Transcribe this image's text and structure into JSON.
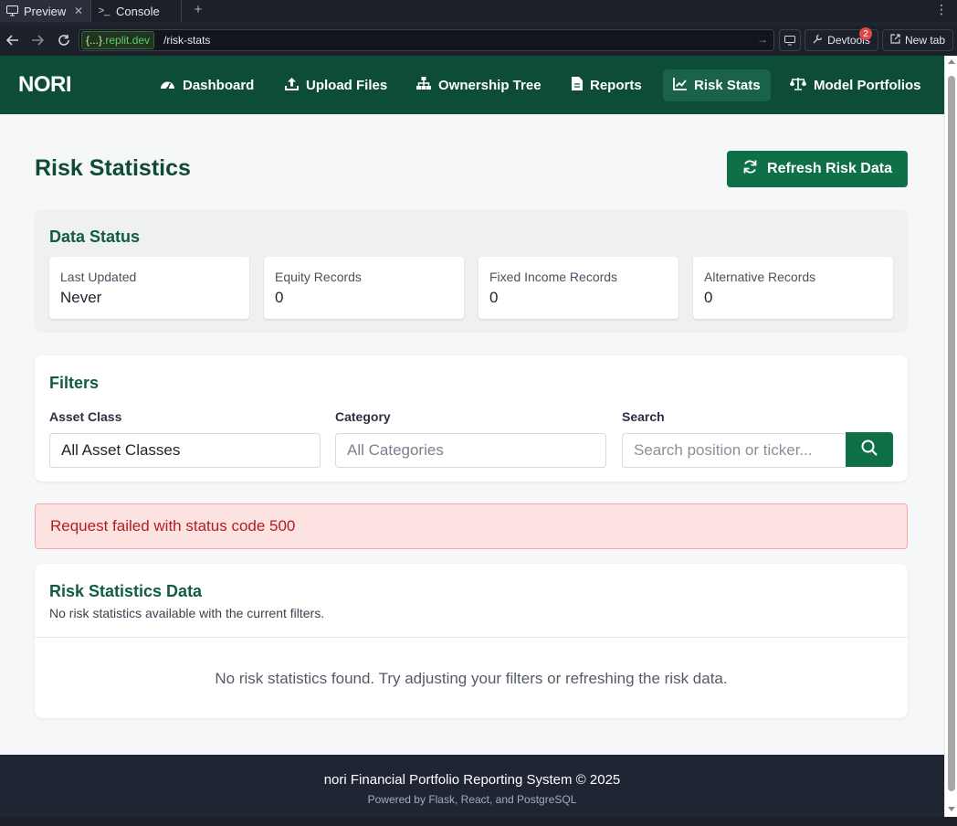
{
  "browser": {
    "tabs": [
      {
        "label": "Preview",
        "icon": "monitor-icon"
      },
      {
        "label": "Console",
        "icon": "terminal-icon"
      }
    ],
    "url": {
      "domain_prefix": "{...}",
      "domain": ".replit.dev",
      "path": "/risk-stats"
    },
    "devtools_label": "Devtools",
    "devtools_badge": "2",
    "new_tab_label": "New tab"
  },
  "app": {
    "brand": "NORI",
    "nav": [
      {
        "label": "Dashboard",
        "icon": "gauge-icon"
      },
      {
        "label": "Upload Files",
        "icon": "upload-icon"
      },
      {
        "label": "Ownership Tree",
        "icon": "sitemap-icon"
      },
      {
        "label": "Reports",
        "icon": "document-icon"
      },
      {
        "label": "Risk Stats",
        "icon": "line-chart-icon",
        "active": true
      },
      {
        "label": "Model Portfolios",
        "icon": "scale-icon"
      }
    ]
  },
  "page": {
    "title": "Risk Statistics",
    "refresh_label": "Refresh Risk Data"
  },
  "data_status": {
    "title": "Data Status",
    "cards": [
      {
        "label": "Last Updated",
        "value": "Never"
      },
      {
        "label": "Equity Records",
        "value": "0"
      },
      {
        "label": "Fixed Income Records",
        "value": "0"
      },
      {
        "label": "Alternative Records",
        "value": "0"
      }
    ]
  },
  "filters": {
    "title": "Filters",
    "asset_class_label": "Asset Class",
    "asset_class_value": "All Asset Classes",
    "category_label": "Category",
    "category_value": "All Categories",
    "search_label": "Search",
    "search_placeholder": "Search position or ticker..."
  },
  "error": {
    "message": "Request failed with status code 500"
  },
  "risk_data": {
    "title": "Risk Statistics Data",
    "subtitle": "No risk statistics available with the current filters.",
    "empty_message": "No risk statistics found. Try adjusting your filters or refreshing the risk data."
  },
  "footer": {
    "main": "nori Financial Portfolio Reporting System © 2025",
    "sub": "Powered by Flask, React, and PostgreSQL"
  },
  "colors": {
    "brand_green": "#0d4d35",
    "button_green": "#0f7048",
    "error_bg": "#fde2e2",
    "footer_bg": "#1f2533"
  }
}
